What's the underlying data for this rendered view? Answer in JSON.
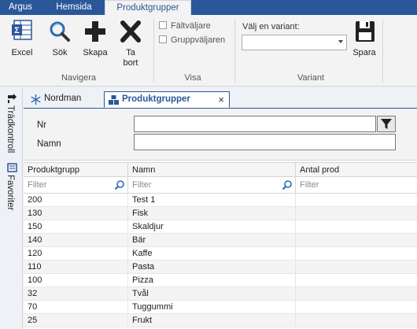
{
  "ribbon": {
    "tabs": [
      {
        "label": "Argus"
      },
      {
        "label": "Hemsida"
      },
      {
        "label": "Produktgrupper",
        "active": true
      }
    ],
    "buttons": {
      "excel": "Excel",
      "search": "Sök",
      "create": "Skapa",
      "delete_line1": "Ta",
      "delete_line2": "bort",
      "save": "Spara"
    },
    "groups": {
      "navigate": "Navigera",
      "show": "Visa",
      "variant": "Variant"
    },
    "checkboxes": {
      "field_selector": "Fältväljare",
      "group_selector": "Gruppväljaren"
    },
    "variant": {
      "label": "Välj en variant:",
      "value": ""
    },
    "colors": {
      "tab_bar": "#2b579a",
      "delete_icon": "#1e1e1e",
      "search_icon": "#2b6cb0"
    }
  },
  "side_panel": {
    "items": [
      {
        "label": "Trädkontroll",
        "icon": "tree-icon"
      },
      {
        "label": "Favoriter",
        "icon": "favorites-icon"
      }
    ]
  },
  "doc_tabs": [
    {
      "label": "Nordman",
      "icon": "snowflake-icon"
    },
    {
      "label": "Produktgrupper",
      "icon": "product-groups-icon",
      "active": true,
      "close": "×"
    }
  ],
  "form": {
    "nr_label": "Nr",
    "nr_value": "",
    "name_label": "Namn",
    "name_value": ""
  },
  "grid": {
    "columns": [
      "Produktgrupp",
      "Namn",
      "Antal prod"
    ],
    "filter_placeholder": "Filter",
    "rows": [
      {
        "group": "200",
        "name": "Test 1",
        "count": ""
      },
      {
        "group": "130",
        "name": "Fisk",
        "count": ""
      },
      {
        "group": "150",
        "name": "Skaldjur",
        "count": ""
      },
      {
        "group": "140",
        "name": "Bär",
        "count": ""
      },
      {
        "group": "120",
        "name": "Kaffe",
        "count": ""
      },
      {
        "group": "110",
        "name": "Pasta",
        "count": ""
      },
      {
        "group": "100",
        "name": "Pizza",
        "count": ""
      },
      {
        "group": "32",
        "name": "Tvål",
        "count": ""
      },
      {
        "group": "70",
        "name": "Tuggummi",
        "count": ""
      },
      {
        "group": "25",
        "name": "Frukt",
        "count": ""
      }
    ]
  }
}
